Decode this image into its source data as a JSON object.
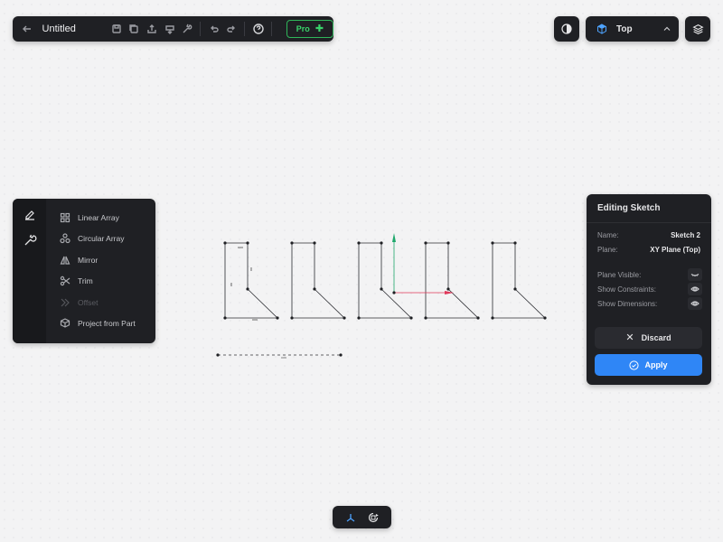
{
  "toolbar": {
    "title": "Untitled",
    "pro_label": "Pro",
    "icons": [
      "back-arrow-icon",
      "save-icon",
      "copy-icon",
      "share-icon",
      "download-icon",
      "wrench-icon",
      "undo-icon",
      "redo-icon",
      "help-icon"
    ]
  },
  "view": {
    "label": "Top"
  },
  "left_tools": {
    "items": [
      {
        "label": "Linear Array",
        "icon": "linear-array-icon",
        "enabled": true
      },
      {
        "label": "Circular Array",
        "icon": "circular-array-icon",
        "enabled": true
      },
      {
        "label": "Mirror",
        "icon": "mirror-icon",
        "enabled": true
      },
      {
        "label": "Trim",
        "icon": "scissors-icon",
        "enabled": true
      },
      {
        "label": "Offset",
        "icon": "offset-icon",
        "enabled": false
      },
      {
        "label": "Project from Part",
        "icon": "project-icon",
        "enabled": true
      }
    ]
  },
  "sketch_panel": {
    "title": "Editing Sketch",
    "name_label": "Name:",
    "name_value": "Sketch 2",
    "plane_label": "Plane:",
    "plane_value": "XY Plane (Top)",
    "plane_visible_label": "Plane Visible:",
    "show_constraints_label": "Show Constraints:",
    "show_dimensions_label": "Show Dimensions:",
    "discard_label": "Discard",
    "apply_label": "Apply"
  },
  "colors": {
    "panel": "#1f2024",
    "accent_blue": "#2f86f6",
    "pro_green": "#39d36a",
    "axis_green": "#1ea86b",
    "axis_red": "#e0385a"
  }
}
